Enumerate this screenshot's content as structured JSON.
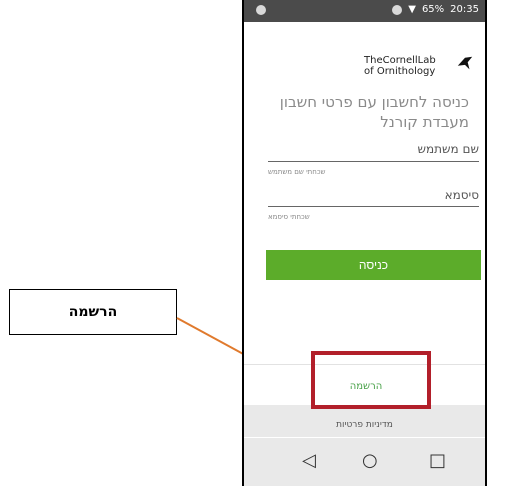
{
  "statusbar": {
    "battery": "65%",
    "time": "20:35"
  },
  "logo": {
    "line1": "TheCornellLab",
    "line2": "of Ornithology"
  },
  "login": {
    "title": "כניסה לחשבון עם פרטי חשבון מעבדת קורנל",
    "username_label": "שם משתמש",
    "forgot_username": "שכחתי שם משתמש",
    "password_label": "סיסמא",
    "forgot_password": "שכחתי סיסמא",
    "submit_label": "כניסה",
    "register_label": "הרשמה",
    "privacy_label": "מדיניות פרטיות"
  },
  "annotation": {
    "label": "הרשמה"
  },
  "colors": {
    "primary_green": "#5cac2a",
    "link_green": "#4aa24a",
    "highlight_red": "#b21f2a",
    "arrow_orange": "#e07a2d"
  },
  "icons": {
    "back": "◁",
    "home": "○",
    "recent": "□"
  }
}
